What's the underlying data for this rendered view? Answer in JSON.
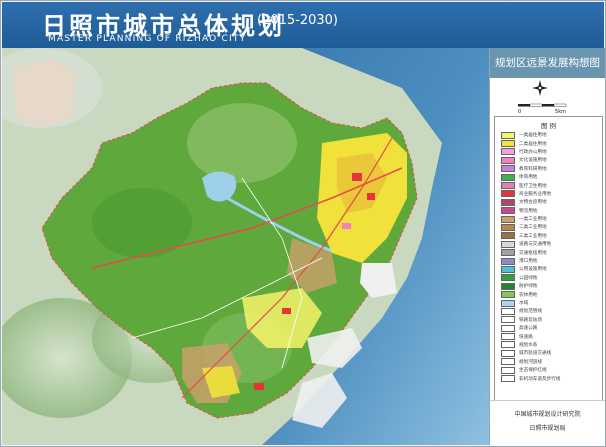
{
  "header": {
    "title_cn": "日照市城市总体规划",
    "title_years": "(2015-2030)",
    "title_en": "MASTER PLANNING OF RIZHAO CITY"
  },
  "panel": {
    "subtitle": "规划区远景发展构想图"
  },
  "legend": {
    "title": "图 例",
    "items": [
      {
        "label": "一类居住用地",
        "color": "#f6f36a"
      },
      {
        "label": "二类居住用地",
        "color": "#f0e23a"
      },
      {
        "label": "行政办公用地",
        "color": "#f5a0d8"
      },
      {
        "label": "文化设施用地",
        "color": "#f47fbf"
      },
      {
        "label": "教育科研用地",
        "color": "#c880e0"
      },
      {
        "label": "体育用地",
        "color": "#3fb04a"
      },
      {
        "label": "医疗卫生用地",
        "color": "#e07fb0"
      },
      {
        "label": "商业服务业用地",
        "color": "#e8323c"
      },
      {
        "label": "文物古迹用地",
        "color": "#b0486a"
      },
      {
        "label": "物流用地",
        "color": "#c94a8c"
      },
      {
        "label": "一类工业用地",
        "color": "#c9a06a"
      },
      {
        "label": "二类工业用地",
        "color": "#b58850"
      },
      {
        "label": "三类工业用地",
        "color": "#9a7040"
      },
      {
        "label": "道路与交通用地",
        "color": "#d8d8d8"
      },
      {
        "label": "交通枢纽用地",
        "color": "#a0a0a0"
      },
      {
        "label": "港口用地",
        "color": "#8c8cc8"
      },
      {
        "label": "公用设施用地",
        "color": "#4fc0d8"
      },
      {
        "label": "公园绿地",
        "color": "#2ea33a"
      },
      {
        "label": "防护绿地",
        "color": "#1f8a2c"
      },
      {
        "label": "农林用地",
        "color": "#86c45a"
      },
      {
        "label": "水域",
        "color": "#a8d4ec"
      },
      {
        "label": "规划范围线",
        "color": "#ffffff"
      },
      {
        "label": "铁路及站场",
        "color": "#ffffff"
      },
      {
        "label": "高速公路",
        "color": "#ffffff"
      },
      {
        "label": "快速路",
        "color": "#ffffff"
      },
      {
        "label": "规划水系",
        "color": "#ffffff"
      },
      {
        "label": "城市轨道交通线",
        "color": "#ffffff"
      },
      {
        "label": "规划河道线",
        "color": "#ffffff"
      },
      {
        "label": "生态保护红线",
        "color": "#ffffff"
      },
      {
        "label": "非机动车道及步行线",
        "color": "#ffffff"
      }
    ]
  },
  "compass": {
    "label": "N"
  },
  "scale": {
    "start": "0",
    "end": "5km"
  },
  "credits": {
    "line1": "中国城市规划设计研究院",
    "line2": "日照市规划局"
  },
  "colors": {
    "header": "#2f6fae",
    "sea": "#3f7fb0",
    "land_green": "#6cb24a",
    "urban_yellow": "#f0e23a",
    "mountain": "#a8c89a"
  },
  "icons": [
    "compass-icon"
  ]
}
